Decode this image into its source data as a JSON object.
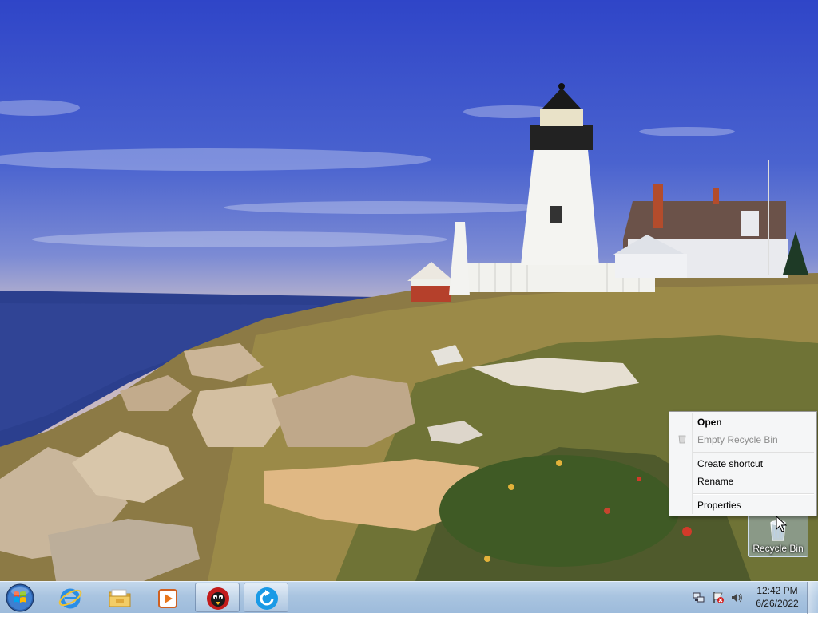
{
  "desktop": {
    "wallpaper": "lighthouse-coast-wallpaper",
    "icons": [
      {
        "label": "Recycle Bin",
        "icon": "recycle-bin-icon"
      }
    ]
  },
  "context_menu": {
    "items": [
      {
        "label": "Open",
        "bold": true,
        "enabled": true
      },
      {
        "label": "Empty Recycle Bin",
        "enabled": false,
        "icon": "empty-bin-icon"
      },
      {
        "label": "Create shortcut",
        "enabled": true
      },
      {
        "label": "Rename",
        "enabled": true
      },
      {
        "label": "Properties",
        "enabled": true
      }
    ]
  },
  "taskbar": {
    "start_icon": "windows-start-orb-icon",
    "buttons": [
      {
        "name": "internet-explorer",
        "icon": "internet-explorer-icon",
        "running": false
      },
      {
        "name": "windows-explorer",
        "icon": "folder-icon",
        "running": false
      },
      {
        "name": "media-player",
        "icon": "media-player-icon",
        "running": false
      },
      {
        "name": "bird-app",
        "icon": "bird-app-icon",
        "running": true
      },
      {
        "name": "refresh-app",
        "icon": "refresh-app-icon",
        "running": true
      }
    ],
    "tray": {
      "icons": [
        "network-icon",
        "action-center-flag-icon",
        "volume-icon"
      ],
      "time": "12:42 PM",
      "date": "6/26/2022"
    }
  },
  "colors": {
    "taskbar": "#a9c4e0",
    "menu_background": "#f5f6f7",
    "sky_top": "#2f45c8"
  }
}
